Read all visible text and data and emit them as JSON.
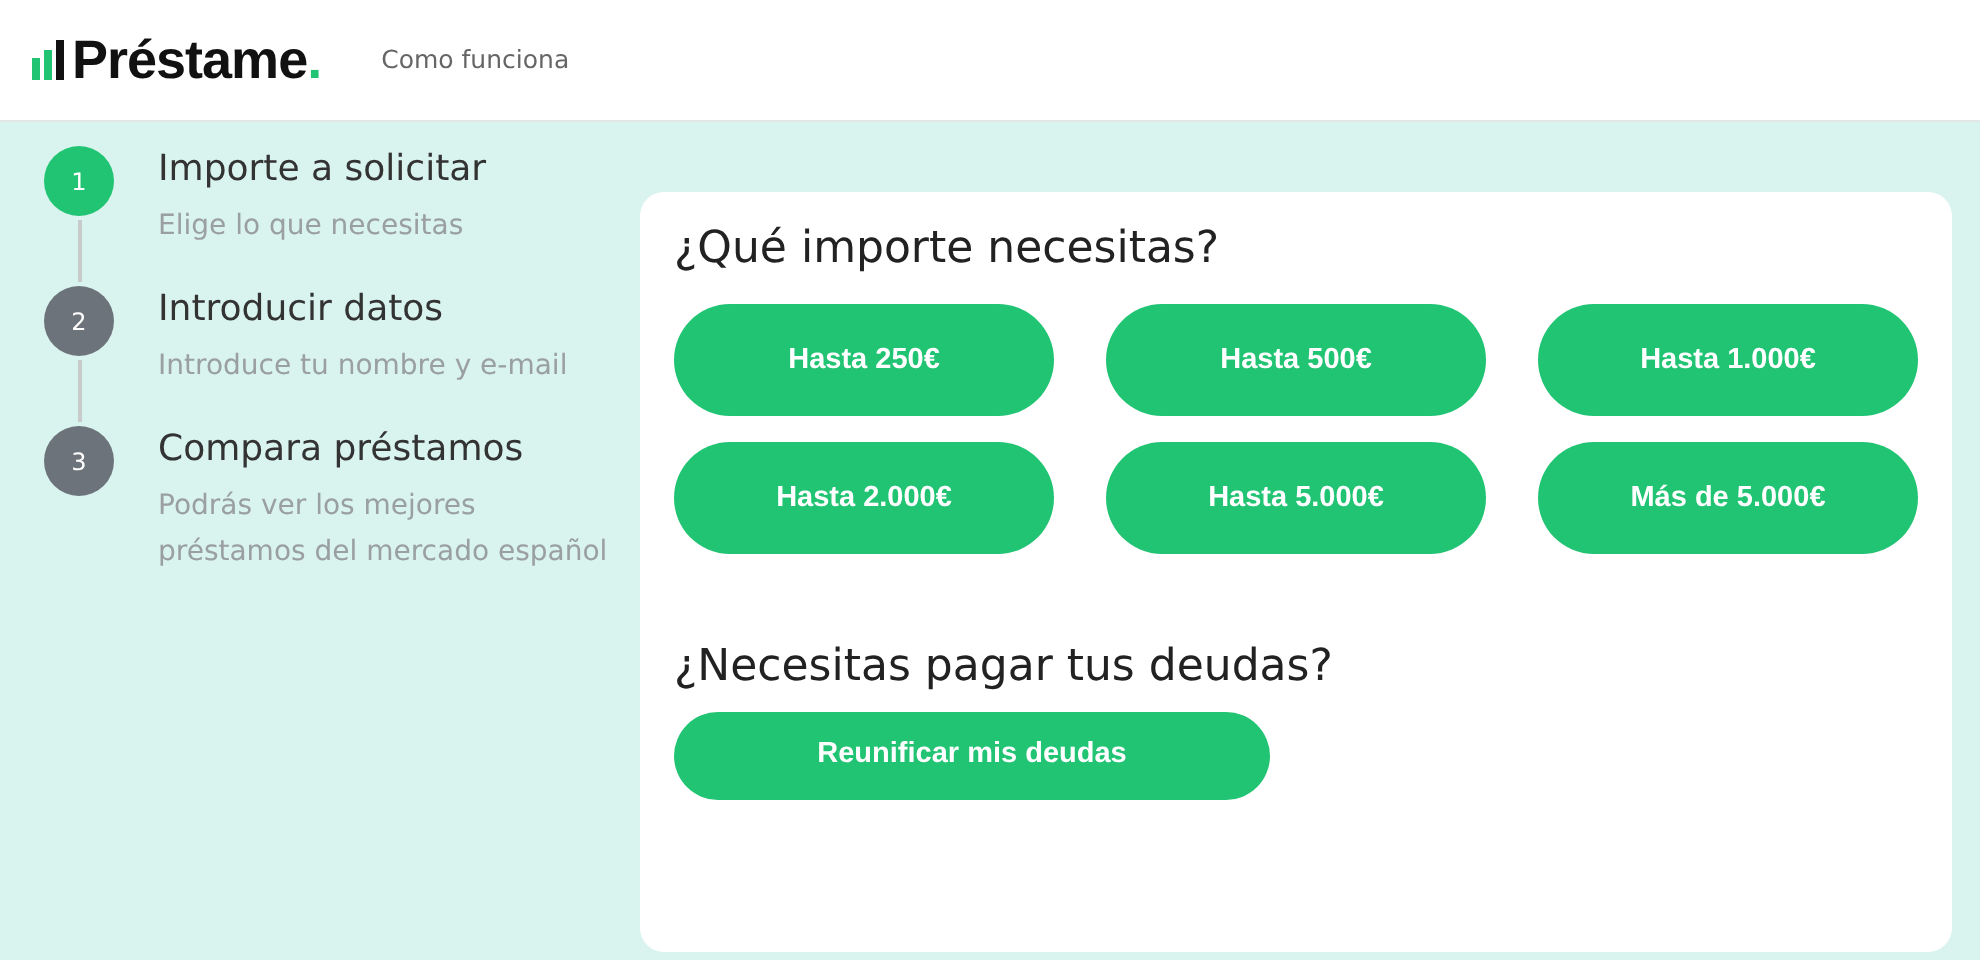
{
  "header": {
    "logo": {
      "text": "Préstame",
      "dot": "."
    },
    "nav": [
      "Como funciona"
    ]
  },
  "steps": [
    {
      "number": "1",
      "title": "Importe a solicitar",
      "description": "Elige lo que necesitas",
      "selected": true
    },
    {
      "number": "2",
      "title": "Introducir datos",
      "description": "Introduce tu nombre y e-mail",
      "selected": false
    },
    {
      "number": "3",
      "title": "Compara préstamos",
      "description": "Podrás ver los mejores préstamos del mercado español",
      "selected": false
    }
  ],
  "amount_section": {
    "heading": "¿Qué importe necesitas?",
    "buttons": [
      "Hasta 250€",
      "Hasta 500€",
      "Hasta 1.000€",
      "Hasta 2.000€",
      "Hasta 5.000€",
      "Más de 5.000€"
    ]
  },
  "debt_section": {
    "heading": "¿Necesitas pagar tus deudas?",
    "button": "Reunificar mis deudas"
  }
}
